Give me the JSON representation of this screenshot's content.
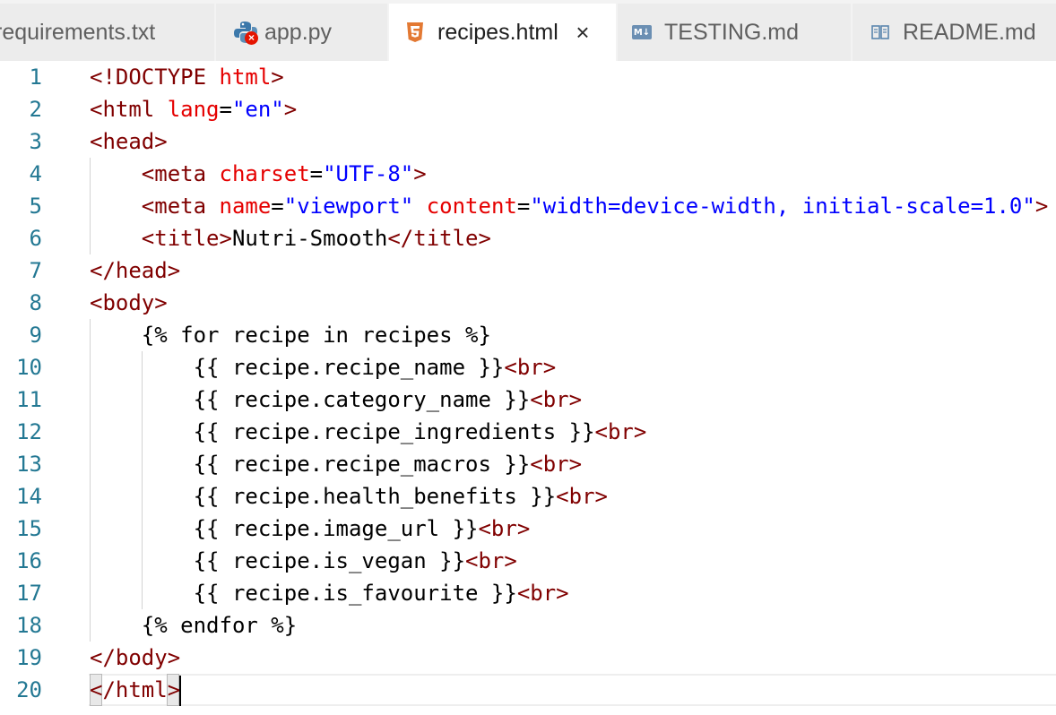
{
  "tabs": [
    {
      "label": "requirements.txt",
      "icon": "text-file-icon",
      "active": false
    },
    {
      "label": "app.py",
      "icon": "python-file-icon",
      "error": true,
      "active": false
    },
    {
      "label": "recipes.html",
      "icon": "html5-file-icon",
      "active": true,
      "close": "×"
    },
    {
      "label": "TESTING.md",
      "icon": "markdown-file-icon",
      "icon_text": "M↓",
      "active": false
    },
    {
      "label": "README.md",
      "icon": "readme-book-icon",
      "active": false
    }
  ],
  "colors": {
    "line_number": "#237893",
    "tag": "#800000",
    "attribute": "#e50000",
    "string": "#0000ff",
    "html5_icon": "#e37933",
    "python_icon": "#3c78aa",
    "error_badge": "#e51400"
  },
  "editor": {
    "lines": [
      {
        "n": "1",
        "tokens": [
          [
            "t",
            "<!DOCTYPE "
          ],
          [
            "a",
            "html"
          ],
          [
            "t",
            ">"
          ]
        ]
      },
      {
        "n": "2",
        "tokens": [
          [
            "t",
            "<html "
          ],
          [
            "a",
            "lang"
          ],
          [
            "p",
            "="
          ],
          [
            "s",
            "\"en\""
          ],
          [
            "t",
            ">"
          ]
        ]
      },
      {
        "n": "3",
        "tokens": [
          [
            "t",
            "<head>"
          ]
        ]
      },
      {
        "n": "4",
        "tokens": [
          [
            "p",
            "    "
          ],
          [
            "t",
            "<meta "
          ],
          [
            "a",
            "charset"
          ],
          [
            "p",
            "="
          ],
          [
            "s",
            "\"UTF-8\""
          ],
          [
            "t",
            ">"
          ]
        ]
      },
      {
        "n": "5",
        "tokens": [
          [
            "p",
            "    "
          ],
          [
            "t",
            "<meta "
          ],
          [
            "a",
            "name"
          ],
          [
            "p",
            "="
          ],
          [
            "s",
            "\"viewport\""
          ],
          [
            "p",
            " "
          ],
          [
            "a",
            "content"
          ],
          [
            "p",
            "="
          ],
          [
            "s",
            "\"width=device-width, initial-scale=1.0\""
          ],
          [
            "t",
            ">"
          ]
        ]
      },
      {
        "n": "6",
        "tokens": [
          [
            "p",
            "    "
          ],
          [
            "t",
            "<title>"
          ],
          [
            "p",
            "Nutri-Smooth"
          ],
          [
            "t",
            "</title>"
          ]
        ]
      },
      {
        "n": "7",
        "tokens": [
          [
            "t",
            "</head>"
          ]
        ]
      },
      {
        "n": "8",
        "tokens": [
          [
            "t",
            "<body>"
          ]
        ]
      },
      {
        "n": "9",
        "tokens": [
          [
            "p",
            "    {% for recipe in recipes %}"
          ]
        ]
      },
      {
        "n": "10",
        "tokens": [
          [
            "p",
            "        {{ recipe.recipe_name }}"
          ],
          [
            "t",
            "<br>"
          ]
        ]
      },
      {
        "n": "11",
        "tokens": [
          [
            "p",
            "        {{ recipe.category_name }}"
          ],
          [
            "t",
            "<br>"
          ]
        ]
      },
      {
        "n": "12",
        "tokens": [
          [
            "p",
            "        {{ recipe.recipe_ingredients }}"
          ],
          [
            "t",
            "<br>"
          ]
        ]
      },
      {
        "n": "13",
        "tokens": [
          [
            "p",
            "        {{ recipe.recipe_macros }}"
          ],
          [
            "t",
            "<br>"
          ]
        ]
      },
      {
        "n": "14",
        "tokens": [
          [
            "p",
            "        {{ recipe.health_benefits }}"
          ],
          [
            "t",
            "<br>"
          ]
        ]
      },
      {
        "n": "15",
        "tokens": [
          [
            "p",
            "        {{ recipe.image_url }}"
          ],
          [
            "t",
            "<br>"
          ]
        ]
      },
      {
        "n": "16",
        "tokens": [
          [
            "p",
            "        {{ recipe.is_vegan }}"
          ],
          [
            "t",
            "<br>"
          ]
        ]
      },
      {
        "n": "17",
        "tokens": [
          [
            "p",
            "        {{ recipe.is_favourite }}"
          ],
          [
            "t",
            "<br>"
          ]
        ]
      },
      {
        "n": "18",
        "tokens": [
          [
            "p",
            "    {% endfor %}"
          ]
        ]
      },
      {
        "n": "19",
        "tokens": [
          [
            "t",
            "</body>"
          ]
        ]
      },
      {
        "n": "20",
        "tokens": [
          [
            "t",
            "</html>"
          ]
        ]
      }
    ]
  }
}
